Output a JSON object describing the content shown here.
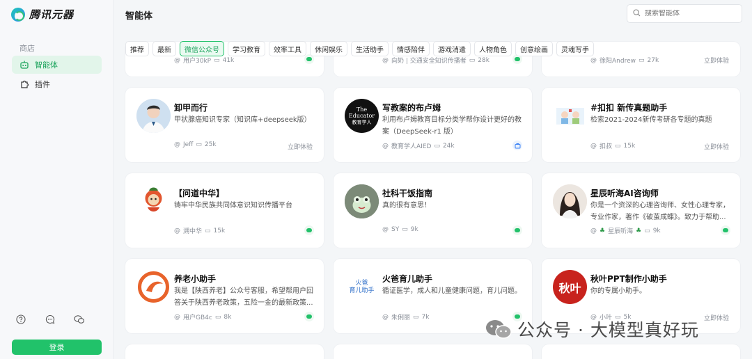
{
  "app": {
    "logo_text": "腾讯元器"
  },
  "sidebar": {
    "section_label": "商店",
    "items": [
      {
        "label": "智能体",
        "icon": "robot-icon",
        "active": true
      },
      {
        "label": "插件",
        "icon": "puzzle-icon",
        "active": false
      }
    ],
    "bottom_icons": [
      "help-icon",
      "chat-icon",
      "wechat-icon"
    ],
    "login_label": "登录"
  },
  "header": {
    "title": "智能体",
    "search_placeholder": "搜索智能体"
  },
  "tabs": [
    "推荐",
    "最新",
    "微信公众号",
    "学习教育",
    "效率工具",
    "休闲娱乐",
    "生活助手",
    "情感陪伴",
    "游戏消遣",
    "人物角色",
    "创意绘画",
    "灵魂写手"
  ],
  "active_tab": "微信公众号",
  "partial_row": [
    {
      "author": "用户30kP",
      "count": "41k"
    },
    {
      "author": "向奶 | 交通安全知识传播者",
      "count": "28k"
    },
    {
      "author": "徐阳Andrew",
      "count": "27k",
      "action": "立即体验"
    }
  ],
  "cards": [
    {
      "title": "卸甲而行",
      "desc": "甲状腺癌知识专家（知识库+deepseek版）",
      "author": "Jeff",
      "count": "25k",
      "action": "立即体验",
      "avatar": "doctor-avatar"
    },
    {
      "title": "写教案的布卢姆",
      "desc": "利用布卢姆教育目标分类学帮你设计更好的教案（DeepSeek-r1 版）",
      "author": "教育学人AIED",
      "count": "24k",
      "avatar": "educator-logo",
      "avatar_text": [
        "The",
        "Educator",
        "教育学人"
      ]
    },
    {
      "title": "#扣扣 新传真题助手",
      "desc": "检索2021-2024新传考研各专题的真题",
      "author": "扣叔",
      "count": "15k",
      "action": "立即体验",
      "avatar": "cartoon-avatar"
    },
    {
      "title": "【问道中华】",
      "desc": "铸牢中华民族共同体意识知识传播平台",
      "author": "溯中华",
      "count": "15k",
      "avatar": "mascot-avatar"
    },
    {
      "title": "社科干饭指南",
      "desc": "真的很有意思！",
      "author": "SY",
      "count": "9k",
      "avatar": "frog-avatar"
    },
    {
      "title": "星辰听海AI咨询师",
      "desc": "你是一个资深的心理咨询师、女性心理专家，专业作家，著作《破茧成蝶》。致力于帮助...",
      "author": "星辰听海",
      "count": "9k",
      "avatar": "woman-avatar"
    },
    {
      "title": "养老小助手",
      "desc": "我是【陕西养老】公众号客服，希望帮用户回答关于陕西养老政策，五险一金的最新政策...",
      "author": "用户GB4c",
      "count": "8k",
      "avatar": "orange-logo"
    },
    {
      "title": "火爸育儿助手",
      "desc": "循证医学，成人和儿童健康问题，育儿问题。",
      "author": "朱俐丽",
      "count": "7k",
      "avatar": "parenting-logo",
      "avatar_text": [
        "火爸",
        "育儿助手"
      ]
    },
    {
      "title": "秋叶PPT制作小助手",
      "desc": "你的专属小助手。",
      "author": "小叶",
      "count": "5k",
      "action": "立即体验",
      "avatar": "qiuye-logo",
      "avatar_text": [
        "秋叶"
      ]
    }
  ],
  "watermark": "公众号 · 大模型真好玩",
  "colors": {
    "brand": "#21c26a",
    "active_bg": "#e2f5ea",
    "card_bg": "#ffffff",
    "page_bg": "#f4f6f8"
  }
}
